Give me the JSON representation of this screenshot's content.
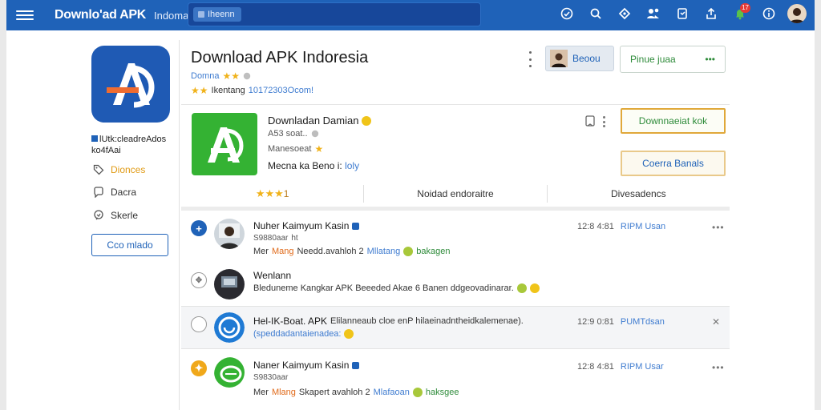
{
  "topbar": {
    "brand": "Downlo'ad APK",
    "brand_sub": "Indoma",
    "search_chip": "Iheenn",
    "notif_count": "17",
    "icons": [
      "check-circle-icon",
      "search-icon",
      "diamond-icon",
      "apps-icon",
      "bookmark-icon",
      "share-icon",
      "bell-icon",
      "info-icon"
    ]
  },
  "sidebar": {
    "title": "lUtk:cleadreAdos",
    "subtitle": "ko4fAai",
    "items": [
      {
        "label": "Dionces",
        "icon": "tag-icon",
        "active": true
      },
      {
        "label": "Dacra",
        "icon": "chat-icon",
        "active": false
      },
      {
        "label": "Skerle",
        "icon": "share-bubble-icon",
        "active": false
      }
    ],
    "button": "Cco mlado"
  },
  "header": {
    "title": "Download APK Indoresia",
    "meta_label": "Domna",
    "meta2_text": "Ikentang",
    "meta2_value": "10172303Ocom!",
    "user_button": "Beoou",
    "pin_button": "Pinue juaa",
    "pin_more": "•••"
  },
  "app_card": {
    "name": "Downladan Damian",
    "line2": "A53 soat..",
    "line3": "Manesoeat",
    "line4_prefix": "Mecna ka Beno i:",
    "line4_link": "loly",
    "download_button": "Downnaeiat kok",
    "open_button": "Coerra Banals",
    "stats": [
      {
        "label": "",
        "rating": "1"
      },
      {
        "label": "Noidad endoraitre"
      },
      {
        "label": "Divesadencs"
      }
    ]
  },
  "feed": [
    {
      "name": "Nuher Kaimyum Kasin",
      "sub": "S9880aar",
      "sub_tag": "ht",
      "text_prefix": "Mer",
      "text_orange": "Mang",
      "text_main": "Needd.avahloh 2",
      "text_link": "Mllatang",
      "text_green": "bakagen",
      "time": "12:8 4:81",
      "time_link": "RIPM Usan",
      "more": "•••"
    },
    {
      "name": "Wenlann",
      "text_main": "Bleduneme Kangkar APK Beeeded Akae 6 Banen ddgeovadinarar."
    },
    {
      "name": "Hel-IK-Boat. APK",
      "text_main": "Elilanneaub cloe enP hilaeinadntheidkalemenae).",
      "text_link2": "(speddadantaienadea:",
      "time": "12:9 0:81",
      "time_link": "PUMTdsan",
      "more": "✕"
    },
    {
      "name": "Naner Kaimyum Kasin",
      "sub": "S9830aar",
      "text_prefix": "Mer",
      "text_orange": "Mlang",
      "text_main": "Skapert avahloh 2",
      "text_link": "Mlafaoan",
      "text_green": "haksgee",
      "time": "12:8 4:81",
      "time_link": "RIPM Usar",
      "more": "•••"
    }
  ]
}
